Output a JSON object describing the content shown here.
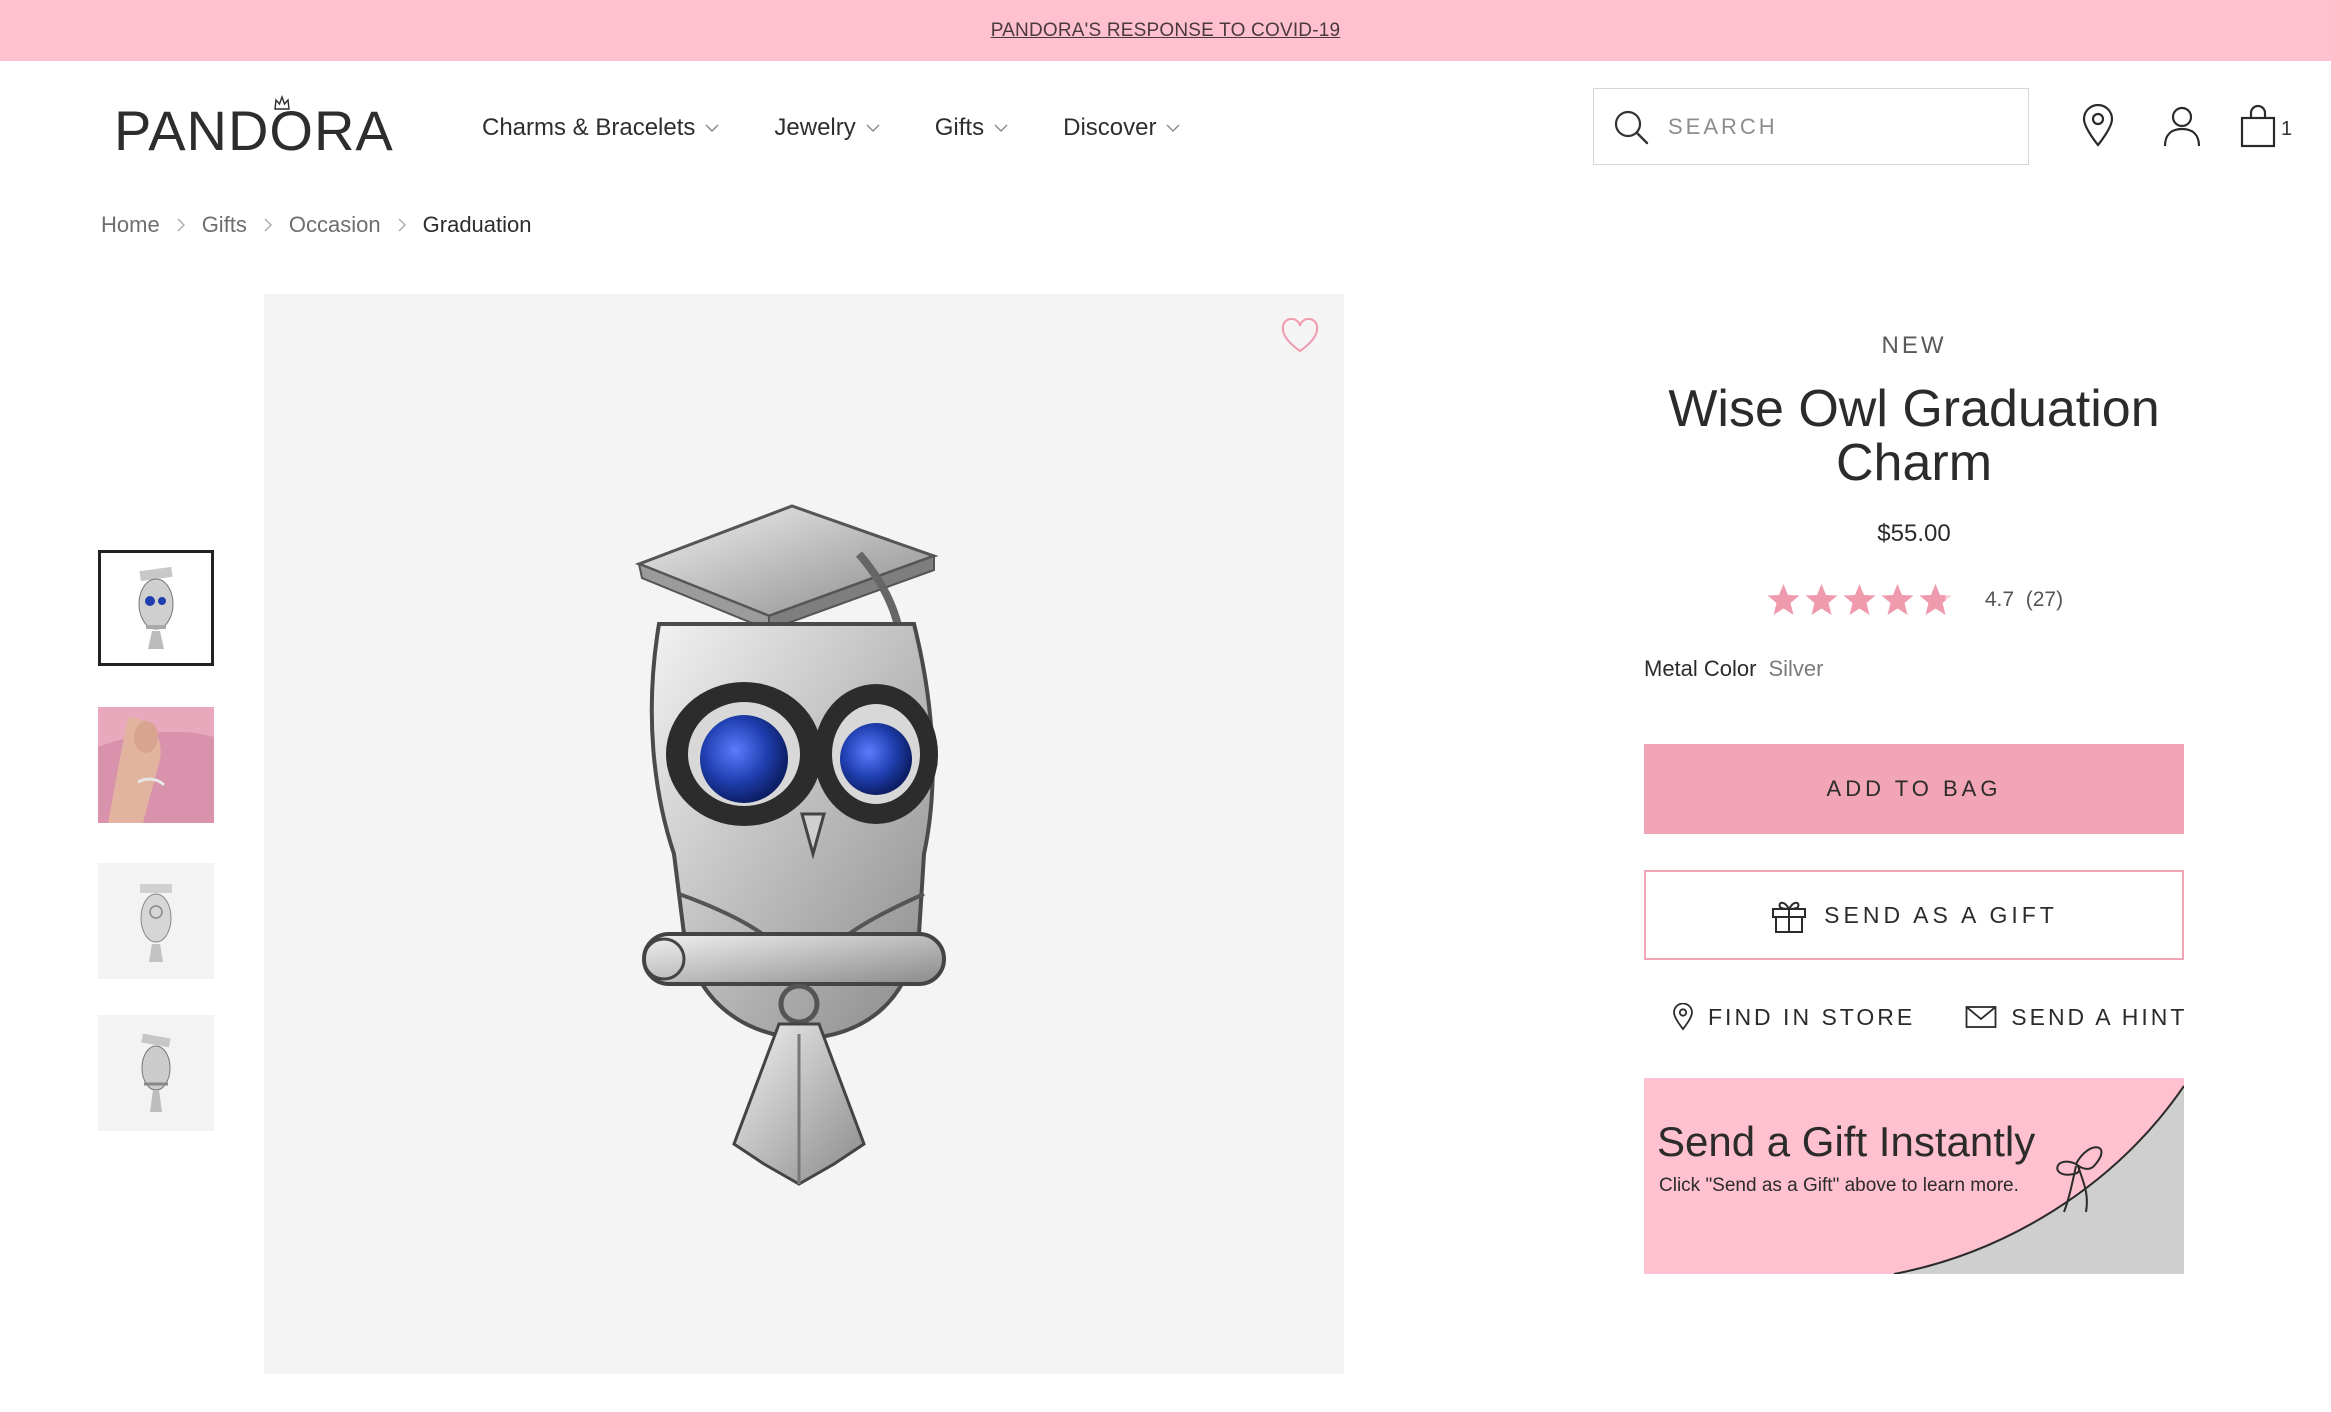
{
  "banner": {
    "link_text": "PANDORA'S RESPONSE TO COVID-19"
  },
  "header": {
    "logo_text": "PANDORA",
    "nav": [
      {
        "label": "Charms & Bracelets"
      },
      {
        "label": "Jewelry"
      },
      {
        "label": "Gifts"
      },
      {
        "label": "Discover"
      }
    ],
    "search": {
      "placeholder": "SEARCH"
    },
    "cart_count": "1",
    "icons": [
      "store-locator-icon",
      "account-icon",
      "shopping-bag-icon"
    ]
  },
  "breadcrumb": {
    "items": [
      "Home",
      "Gifts",
      "Occasion"
    ],
    "current": "Graduation"
  },
  "gallery": {
    "thumbnails": [
      "owl-charm-front",
      "model-wearing-bracelet",
      "owl-charm-side",
      "owl-charm-back"
    ],
    "selected_index": 0
  },
  "product": {
    "badge": "NEW",
    "title": "Wise Owl Graduation Charm",
    "price": "$55.00",
    "rating": {
      "value": "4.7",
      "count": "(27)",
      "stars": 4.7
    },
    "metal_color": {
      "label": "Metal Color",
      "value": "Silver"
    }
  },
  "actions": {
    "add_to_bag": "ADD TO BAG",
    "send_as_gift": "SEND AS A GIFT",
    "find_in_store": "FIND IN STORE",
    "send_hint": "SEND A HINT"
  },
  "promo": {
    "title": "Send a Gift Instantly",
    "subtitle": "Click \"Send as a Gift\" above to learn more."
  },
  "colors": {
    "banner_pink": "#ffc0cf",
    "button_pink": "#f1a5b6",
    "star_pink": "#f09aae",
    "owl_eye_blue": "#1f3fb0"
  }
}
